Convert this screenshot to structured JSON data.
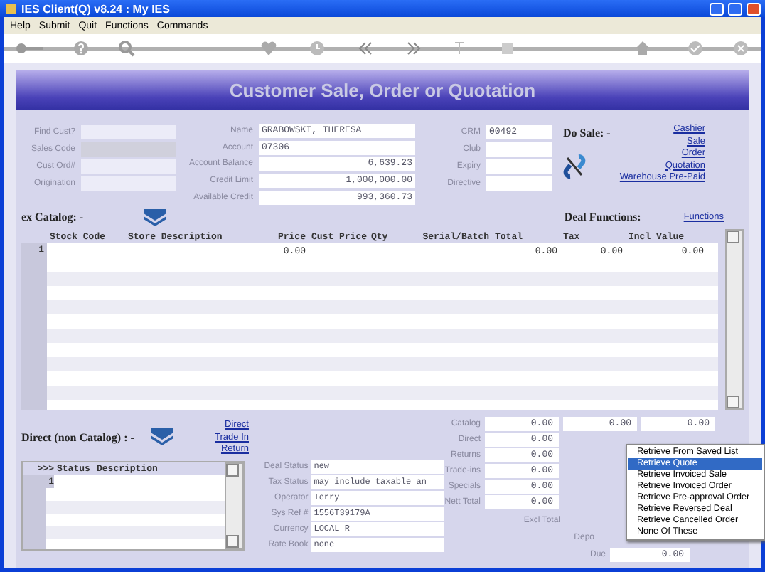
{
  "window": {
    "title": "IES Client(Q) v8.24 : My IES"
  },
  "menu_bar": [
    "Help",
    "Submit",
    "Quit",
    "Functions",
    "Commands"
  ],
  "page_title": "Customer Sale, Order or Quotation",
  "customer_fields": [
    {
      "label": "Find Cust?",
      "disabled": false
    },
    {
      "label": "Sales Code",
      "disabled": true
    },
    {
      "label": "Cust Ord#",
      "disabled": false
    },
    {
      "label": "Origination",
      "disabled": false
    }
  ],
  "account_fields": [
    {
      "label": "Name",
      "value": "GRABOWSKI, THERESA",
      "kind": "text"
    },
    {
      "label": "Account",
      "value": "07306",
      "kind": "text"
    },
    {
      "label": "Account Balance",
      "value": "6,639.23",
      "kind": "amount"
    },
    {
      "label": "Credit Limit",
      "value": "1,000,000.00",
      "kind": "amount"
    },
    {
      "label": "Available Credit",
      "value": "993,360.73",
      "kind": "amount"
    }
  ],
  "crm_fields": [
    {
      "label": "CRM",
      "value": "00492"
    },
    {
      "label": "Club"
    },
    {
      "label": "Expiry"
    },
    {
      "label": "Directive"
    }
  ],
  "do_sale": {
    "label": "Do Sale: -",
    "links": [
      "Cashier",
      "Sale",
      "Order",
      "Quotation",
      "Warehouse Pre-Paid"
    ]
  },
  "catalog": {
    "label": "ex Catalog: -"
  },
  "deal_functions": {
    "label": "Deal Functions:",
    "link": "Functions"
  },
  "items_table": {
    "columns": [
      "Stock Code",
      "Store Description",
      "Price",
      "Cust Price",
      "Qty",
      "Serial/Batch",
      "Total",
      "Tax",
      "Incl Value"
    ],
    "rows": [
      {
        "number": "1",
        "price": "0.00",
        "total": "0.00",
        "tax": "0.00",
        "incl_value": "0.00"
      }
    ]
  },
  "direct": {
    "label": "Direct (non Catalog) : -",
    "links": [
      "Direct",
      "Trade In",
      "Return"
    ]
  },
  "status_table": {
    "columns": [
      ">>>",
      "Status",
      "Description"
    ],
    "rows": [
      {
        "number": "1"
      }
    ]
  },
  "deal_fields": [
    {
      "label": "Deal Status",
      "value": "new"
    },
    {
      "label": "Tax Status",
      "value": "may include taxable an"
    },
    {
      "label": "Operator",
      "value": "Terry"
    },
    {
      "label": "Sys Ref #",
      "value": "1556T39179A"
    },
    {
      "label": "Currency",
      "value": "LOCAL R"
    },
    {
      "label": "Rate Book",
      "value": "none"
    }
  ],
  "totals": [
    {
      "label": "Catalog",
      "values": [
        "0.00",
        "0.00",
        "0.00"
      ]
    },
    {
      "label": "Direct",
      "values": [
        "0.00"
      ]
    },
    {
      "label": "Returns",
      "values": [
        "0.00"
      ]
    },
    {
      "label": "Trade-ins",
      "values": [
        "0.00"
      ]
    },
    {
      "label": "Specials",
      "values": [
        "0.00"
      ]
    },
    {
      "label": "Nett Total",
      "values": [
        "0.00"
      ]
    }
  ],
  "totals_footer": {
    "excl_total": "Excl Total",
    "deposit": "Depo",
    "due_label": "Due",
    "due_value": "0.00"
  },
  "context_menu": [
    {
      "label": "Retrieve From Saved List",
      "selected": false
    },
    {
      "label": "Retrieve Quote",
      "selected": true
    },
    {
      "label": "Retrieve Invoiced Sale",
      "selected": false
    },
    {
      "label": "Retrieve Invoiced Order",
      "selected": false
    },
    {
      "label": "Retrieve Pre-approval Order",
      "selected": false
    },
    {
      "label": "Retrieve Reversed Deal",
      "selected": false
    },
    {
      "label": "Retrieve Cancelled Order",
      "selected": false
    },
    {
      "label": "None Of These",
      "selected": false
    }
  ]
}
